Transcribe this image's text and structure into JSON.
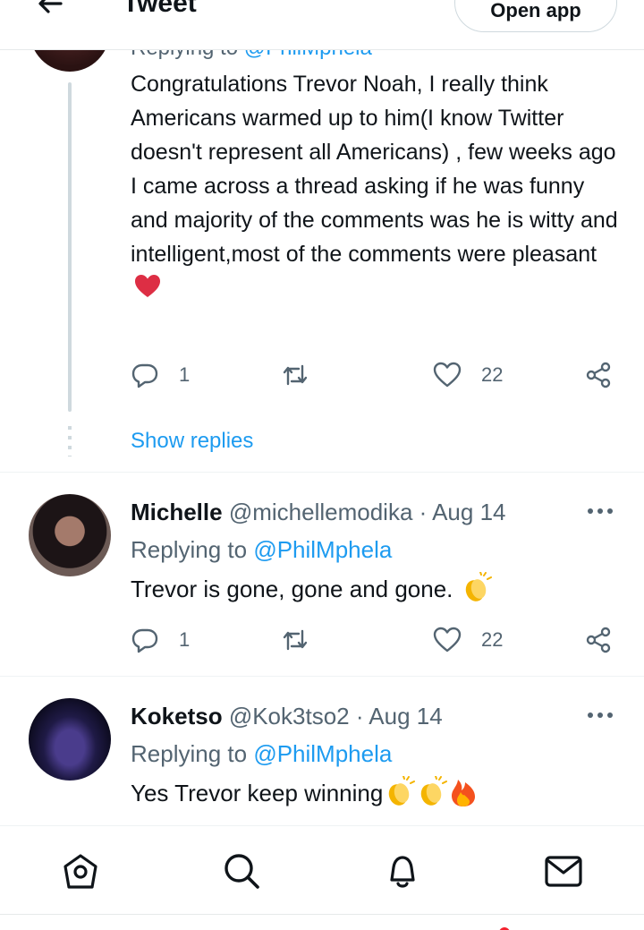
{
  "header": {
    "title": "Tweet",
    "open_app": "Open app",
    "back_icon": "arrow-left-icon"
  },
  "tweet1": {
    "replying_prefix": "Replying to",
    "replying_handle": "@PhilMphela",
    "text": "Congratulations Trevor Noah, I really think Americans warmed up to him(I know Twitter doesn't represent all Americans) , few weeks ago I came across a thread asking if he was funny and majority of the comments was he is witty and intelligent,most of the comments were pleasant",
    "emoji": "red-heart",
    "reply_count": "1",
    "like_count": "22",
    "show_replies": "Show replies"
  },
  "tweet2": {
    "name": "Michelle",
    "handle": "@michellemodika",
    "date": "· Aug 14",
    "replying_prefix": "Replying to",
    "replying_handle": "@PhilMphela",
    "text": "Trevor is gone, gone and gone.",
    "emoji": "clapping-hands",
    "reply_count": "1",
    "like_count": "22"
  },
  "tweet3": {
    "name": "Koketso",
    "handle": "@Kok3tso2",
    "date": "· Aug 14",
    "replying_prefix": "Replying to",
    "replying_handle": "@PhilMphela",
    "text": "Yes Trevor keep winning",
    "emojis": [
      "clapping-hands",
      "clapping-hands",
      "fire"
    ]
  },
  "bottom_nav": {
    "icons": [
      "home-icon",
      "search-icon",
      "bell-icon",
      "mail-icon"
    ]
  },
  "colors": {
    "accent": "#1d9bf0",
    "text": "#0f1419",
    "secondary": "#536471",
    "heart": "#e0245e"
  }
}
